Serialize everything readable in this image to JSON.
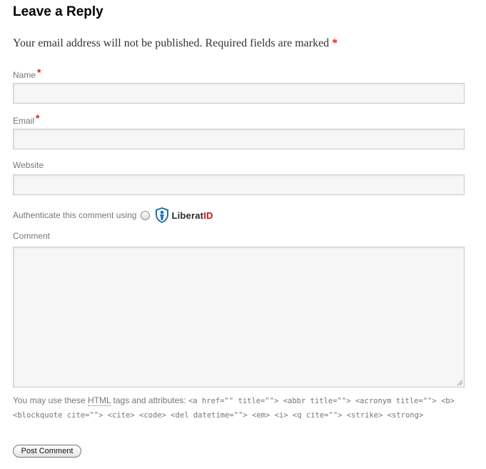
{
  "reply": {
    "title": "Leave a Reply",
    "notes_text": "Your email address will not be published. Required fields are marked",
    "required_mark": "*"
  },
  "fields": {
    "name": {
      "label": "Name",
      "value": ""
    },
    "email": {
      "label": "Email",
      "value": ""
    },
    "website": {
      "label": "Website",
      "value": ""
    }
  },
  "auth": {
    "label": "Authenticate this comment using",
    "logo_text_a": "Liberat",
    "logo_text_b": "ID",
    "logo_icon": "shield-icon"
  },
  "comment": {
    "label": "Comment",
    "value": ""
  },
  "allowed": {
    "prefix": "You may use these",
    "abbr": "HTML",
    "middle": "tags and attributes:",
    "code": "<a href=\"\" title=\"\"> <abbr title=\"\"> <acronym title=\"\"> <b> <blockquote cite=\"\"> <cite> <code> <del datetime=\"\"> <em> <i> <q cite=\"\"> <strike> <strong>"
  },
  "submit": {
    "label": "Post Comment"
  },
  "colors": {
    "required": "#e01b1b",
    "logo_red": "#c4161c",
    "logo_blue": "#1f6fb0"
  }
}
